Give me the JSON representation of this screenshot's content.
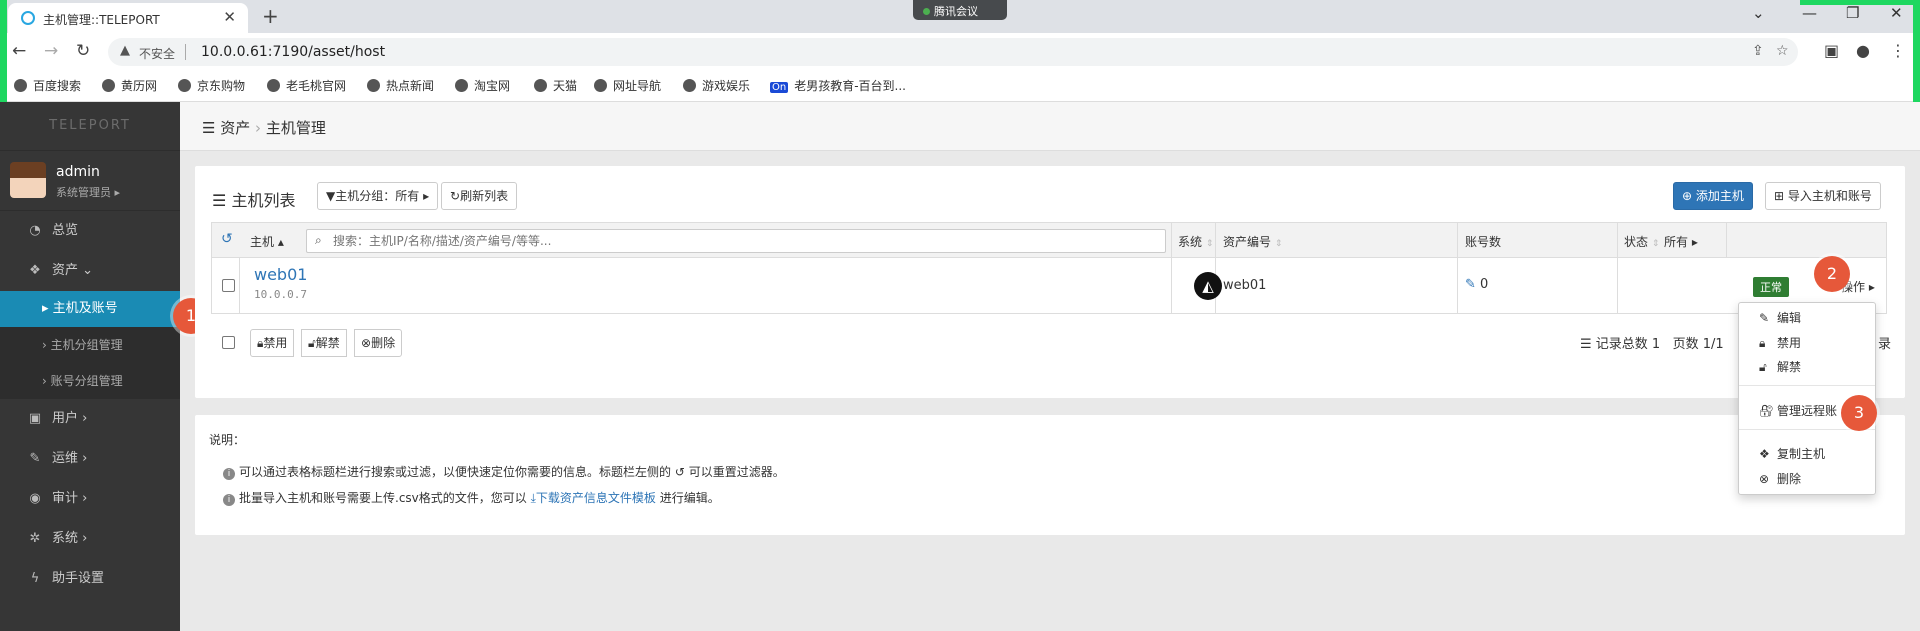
{
  "browser": {
    "tab_title": "主机管理::TELEPORT",
    "meeting": "腾讯会议",
    "insecure_label": "不安全",
    "url": "10.0.0.61:7190/asset/host",
    "bookmarks": [
      "百度搜索",
      "黄历网",
      "京东购物",
      "老毛桃官网",
      "热点新闻",
      "淘宝网",
      "天猫",
      "网址导航",
      "游戏娱乐",
      "老男孩教育-百台到..."
    ],
    "bookmark_badge": "On"
  },
  "sidebar": {
    "logo": "TELEPORT",
    "user_name": "admin",
    "user_role": "系统管理员",
    "items": [
      {
        "label": "总览"
      },
      {
        "label": "资产"
      },
      {
        "label": "主机及账号"
      },
      {
        "label": "主机分组管理"
      },
      {
        "label": "账号分组管理"
      },
      {
        "label": "用户"
      },
      {
        "label": "运维"
      },
      {
        "label": "审计"
      },
      {
        "label": "系统"
      },
      {
        "label": "助手设置"
      }
    ]
  },
  "breadcrumb": {
    "root": "资产",
    "current": "主机管理"
  },
  "panel": {
    "title": "主机列表",
    "group_filter": "主机分组：所有",
    "refresh": "刷新列表",
    "add_host": "添加主机",
    "import": "导入主机和账号",
    "columns": {
      "host": "主机",
      "search_placeholder": "搜索：主机IP/名称/描述/资产编号/等等...",
      "os": "系统",
      "asset_no": "资产编号",
      "accounts": "账号数",
      "status": "状态",
      "status_filter": "所有"
    },
    "row": {
      "name": "web01",
      "ip": "10.0.0.7",
      "asset_no": "web01",
      "accounts": "0",
      "status": "正常",
      "action": "操作"
    },
    "bulk": {
      "disable": "禁用",
      "unlock": "解禁",
      "delete": "删除"
    },
    "pagination": {
      "total": "记录总数 1",
      "pages": "页数 1/1",
      "tail": "录"
    }
  },
  "dropdown": {
    "edit": "编辑",
    "disable": "禁用",
    "unlock": "解禁",
    "manage_accounts": "管理远程账",
    "copy_host": "复制主机",
    "delete": "删除"
  },
  "badges": {
    "one": "1",
    "two": "2",
    "three": "3"
  },
  "notes": {
    "title": "说明：",
    "line1_a": "可以通过表格标题栏进行搜索或过滤，以便快速定位你需要的信息。标题栏左侧的",
    "line1_b": "可以重置过滤器。",
    "line2_a": "批量导入主机和账号需要上传.csv格式的文件，您可以",
    "line2_link": "下载资产信息文件模板",
    "line2_b": "进行编辑。"
  },
  "colors": {
    "accent": "#2e75b6",
    "sidebar": "#363636",
    "active": "#1a8bb4",
    "status_ok": "#2f7d32",
    "badge": "#e6583a"
  }
}
